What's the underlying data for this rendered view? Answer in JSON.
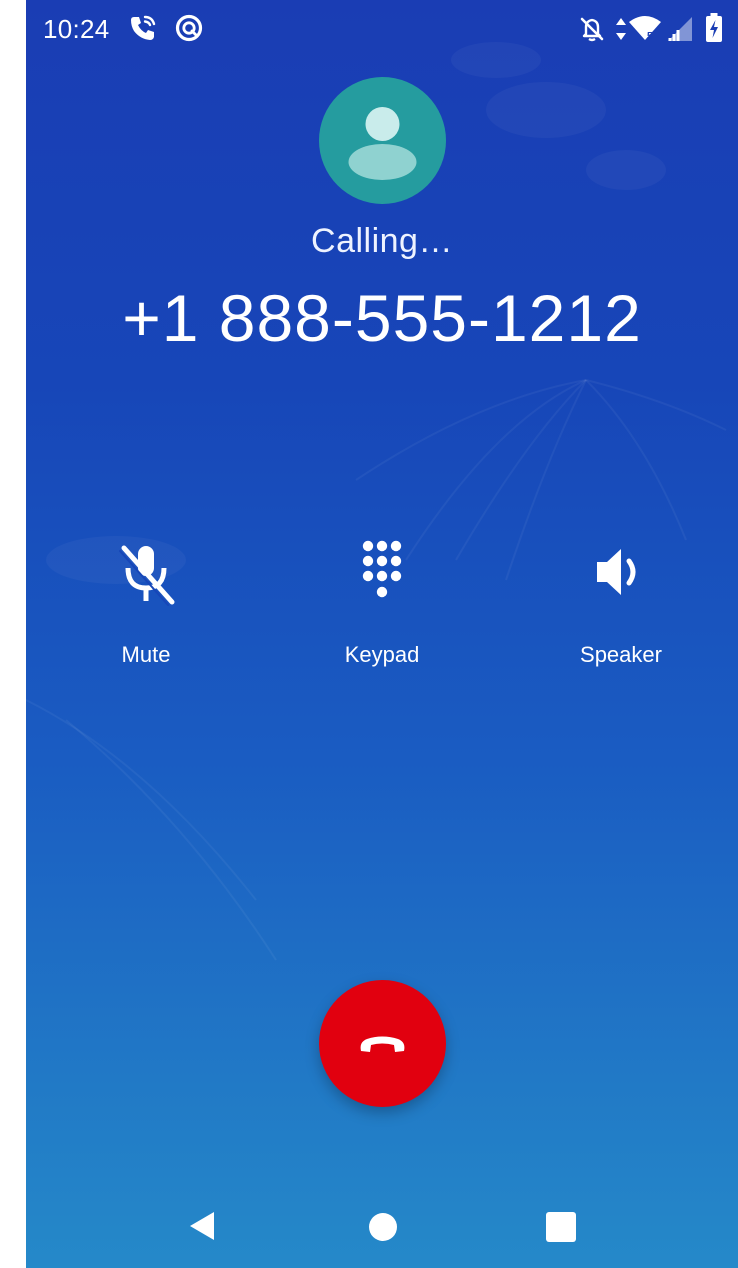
{
  "status_bar": {
    "time": "10:24",
    "icons": [
      "wifi-calling-icon",
      "data-saver-icon",
      "do-not-disturb-off-icon",
      "data-arrows-icon",
      "wifi-icon",
      "cell-signal-icon",
      "battery-charging-icon"
    ]
  },
  "call": {
    "status": "Calling…",
    "number": "+1 888-555-1212",
    "avatar_color": "#259c9f"
  },
  "actions": {
    "mute": "Mute",
    "keypad": "Keypad",
    "speaker": "Speaker"
  },
  "end_call": {
    "color": "#e1000f"
  },
  "nav": {
    "buttons": [
      "back-icon",
      "home-icon",
      "recents-icon"
    ]
  }
}
